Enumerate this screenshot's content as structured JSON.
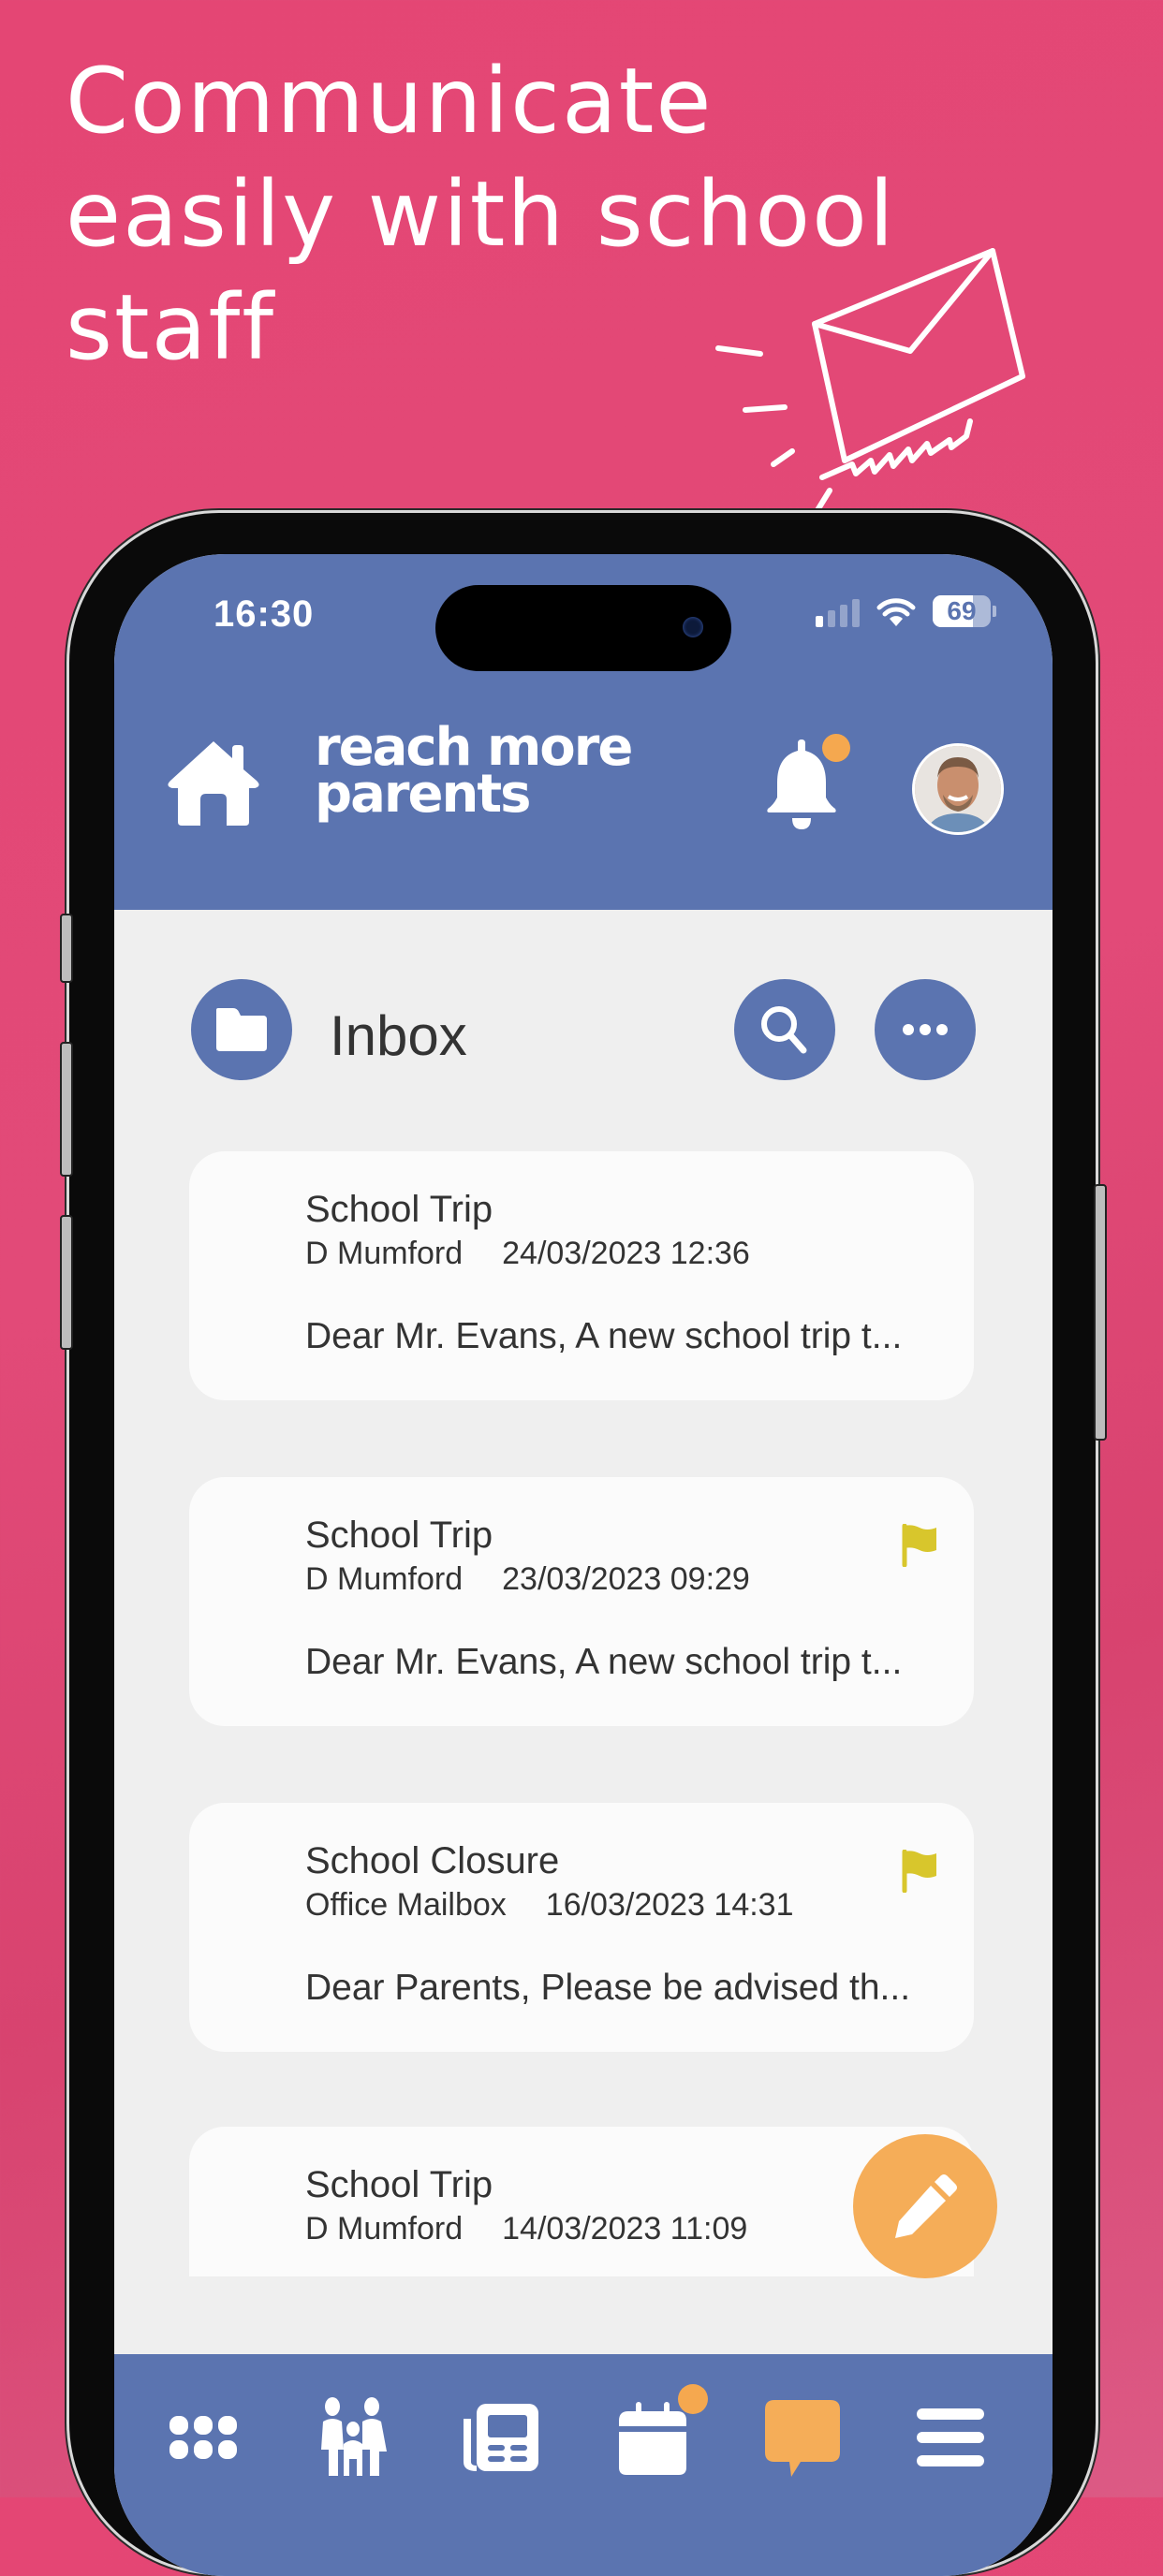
{
  "promo": {
    "headline_lines": [
      "Communicate",
      "easily with school",
      "staff"
    ]
  },
  "status_bar": {
    "time": "16:30",
    "battery": "69",
    "battery_level": 0.69,
    "signal_bars_on": 1,
    "signal_bars_total": 4
  },
  "header": {
    "logo_line1": "reach more",
    "logo_line2": "parents",
    "notification_badge": true
  },
  "inbox": {
    "title": "Inbox"
  },
  "messages": [
    {
      "subject": "School Trip",
      "sender": "D Mumford",
      "date": "24/03/2023 12:36",
      "preview": "Dear Mr. Evans, A new school trip t...",
      "flagged": false
    },
    {
      "subject": "School Trip",
      "sender": "D Mumford",
      "date": "23/03/2023 09:29",
      "preview": "Dear Mr. Evans, A new school trip t...",
      "flagged": true
    },
    {
      "subject": "School Closure",
      "sender": "Office Mailbox",
      "date": "16/03/2023 14:31",
      "preview": "Dear Parents, Please be advised th...",
      "flagged": true
    },
    {
      "subject": "School Trip",
      "sender": "D Mumford",
      "date": "14/03/2023 11:09",
      "preview": "",
      "flagged": false
    }
  ],
  "bottom_nav": [
    {
      "icon": "grid-icon",
      "active": false,
      "badge": false
    },
    {
      "icon": "family-icon",
      "active": false,
      "badge": false
    },
    {
      "icon": "newspaper-icon",
      "active": false,
      "badge": false
    },
    {
      "icon": "calendar-icon",
      "active": false,
      "badge": true
    },
    {
      "icon": "message-icon",
      "active": true,
      "badge": false
    },
    {
      "icon": "menu-icon",
      "active": false,
      "badge": false
    }
  ],
  "colors": {
    "background": "#e44674",
    "brand_blue": "#5b74b0",
    "accent_orange": "#f5ad58",
    "flag_yellow": "#d8c62c",
    "screen_bg": "#efefef",
    "card_bg": "#fbfbfb"
  }
}
